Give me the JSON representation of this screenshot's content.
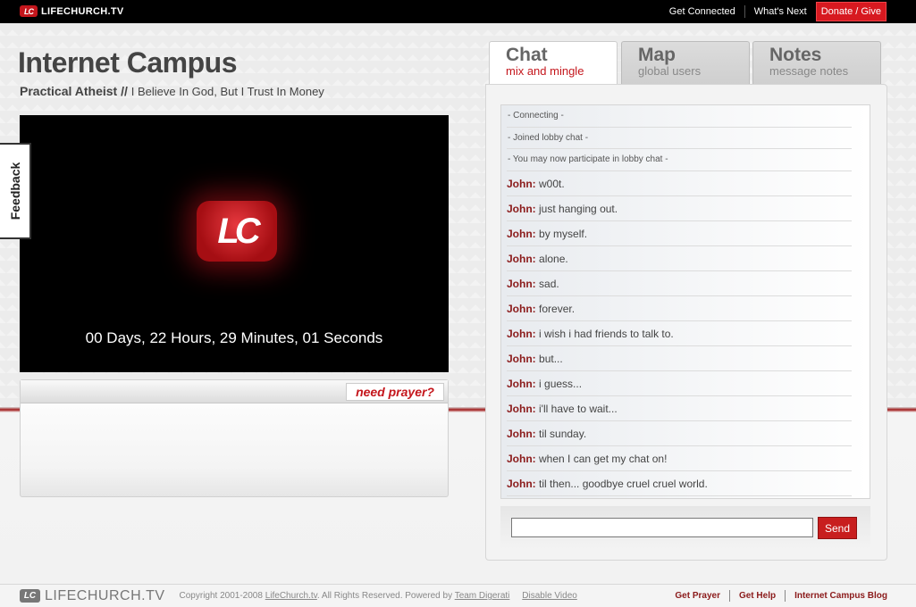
{
  "brand": {
    "name": "LIFECHURCH.TV",
    "mark": "LC"
  },
  "topnav": {
    "items": [
      "Get Connected",
      "What's Next"
    ],
    "donate": "Donate / Give"
  },
  "page": {
    "title": "Internet Campus",
    "series": "Practical Atheist //",
    "message": "I Believe In God, But I Trust In Money"
  },
  "video": {
    "logo": "LC",
    "countdown": "00 Days, 22 Hours, 29 Minutes, 01 Seconds"
  },
  "feedback": {
    "label": "Feedback"
  },
  "prayer": {
    "button": "need prayer?"
  },
  "tabs": [
    {
      "title": "Chat",
      "sub": "mix and mingle"
    },
    {
      "title": "Map",
      "sub": "global users"
    },
    {
      "title": "Notes",
      "sub": "message notes"
    }
  ],
  "chat": {
    "system": [
      "- Connecting -",
      "- Joined lobby chat -",
      "- You may now participate in lobby chat -"
    ],
    "messages": [
      {
        "user": "John:",
        "text": "w00t."
      },
      {
        "user": "John:",
        "text": "just hanging out."
      },
      {
        "user": "John:",
        "text": "by myself."
      },
      {
        "user": "John:",
        "text": "alone."
      },
      {
        "user": "John:",
        "text": "sad."
      },
      {
        "user": "John:",
        "text": "forever."
      },
      {
        "user": "John:",
        "text": "i wish i had friends to talk to."
      },
      {
        "user": "John:",
        "text": "but..."
      },
      {
        "user": "John:",
        "text": "i guess..."
      },
      {
        "user": "John:",
        "text": "i'll have to wait..."
      },
      {
        "user": "John:",
        "text": "til sunday."
      },
      {
        "user": "John:",
        "text": "when I can get my chat on!"
      },
      {
        "user": "John:",
        "text": "til then... goodbye cruel cruel world."
      }
    ],
    "input_value": "",
    "send": "Send"
  },
  "footer": {
    "copyright_prefix": "Copyright 2001-2008",
    "copyright_link": "LifeChurch.tv",
    "rights": ". All Rights Reserved. Powered by",
    "powered_link": "Team Digerati",
    "disable_video": "Disable Video",
    "links": [
      "Get Prayer",
      "Get Help",
      "Internet Campus Blog"
    ]
  },
  "colors": {
    "accent": "#c4161c",
    "username": "#8b1a1a"
  }
}
